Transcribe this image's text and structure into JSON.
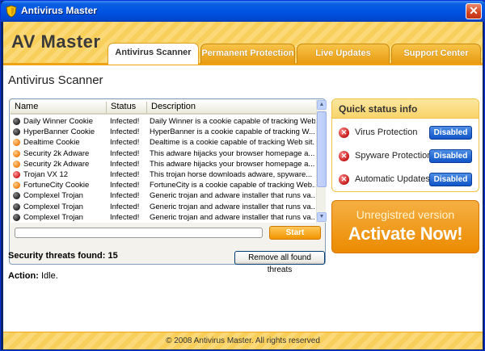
{
  "window": {
    "title": "Antivirus Master",
    "close_label": "✕"
  },
  "header": {
    "brand": "AV Master",
    "tabs": [
      {
        "label": "Antivirus Scanner",
        "active": true
      },
      {
        "label": "Permanent Protection",
        "active": false
      },
      {
        "label": "Live Updates",
        "active": false
      },
      {
        "label": "Support Center",
        "active": false
      }
    ]
  },
  "scanner": {
    "title": "Antivirus Scanner",
    "columns": [
      "Name",
      "Status",
      "Description"
    ],
    "rows": [
      {
        "name": "Daily Winner Cookie",
        "status": "Infected!",
        "description": "Daily Winner is a cookie capable of tracking Web...",
        "severity": "high"
      },
      {
        "name": "HyperBanner Cookie",
        "status": "Infected!",
        "description": "HyperBanner is a cookie capable of tracking W...",
        "severity": "high"
      },
      {
        "name": "Dealtime Cookie",
        "status": "Infected!",
        "description": "Dealtime is a cookie capable of tracking Web sit...",
        "severity": "medium"
      },
      {
        "name": "Security 2k Adware",
        "status": "Infected!",
        "description": "This adware hijacks your browser homepage a...",
        "severity": "medium"
      },
      {
        "name": "Security 2k Adware",
        "status": "Infected!",
        "description": "This adware hijacks your browser homepage a...",
        "severity": "medium"
      },
      {
        "name": "Trojan VX 12",
        "status": "Infected!",
        "description": "This trojan horse downloads adware, spyware...",
        "severity": "critical"
      },
      {
        "name": "FortuneCity Cookie",
        "status": "Infected!",
        "description": "FortuneCity is a cookie capable of tracking Web...",
        "severity": "medium"
      },
      {
        "name": "Complexel Trojan",
        "status": "Infected!",
        "description": "Generic trojan and adware installer that runs va...",
        "severity": "high"
      },
      {
        "name": "Complexel Trojan",
        "status": "Infected!",
        "description": "Generic trojan and adware installer that runs va...",
        "severity": "high"
      },
      {
        "name": "Complexel Trojan",
        "status": "Infected!",
        "description": "Generic trojan and adware installer that runs va...",
        "severity": "high"
      }
    ],
    "progress": 0,
    "start_label": "Start",
    "threats_label": "Security threats found: 15",
    "remove_label": "Remove all found threats",
    "action_label": "Action:",
    "action_value": "Idle."
  },
  "quick_status": {
    "title": "Quick status info",
    "items": [
      {
        "label": "Virus Protection",
        "status": "Disabled"
      },
      {
        "label": "Spyware Protection",
        "status": "Disabled"
      },
      {
        "label": "Automatic Updates",
        "status": "Disabled"
      }
    ]
  },
  "activate": {
    "subtitle": "Unregistred version",
    "button": "Activate Now!"
  },
  "footer": {
    "copyright": "© 2008 Antivirus Master. All rights reserved"
  },
  "colors": {
    "accent": "#f29500",
    "status_disabled": "#1054c8",
    "alert": "#c01010"
  }
}
